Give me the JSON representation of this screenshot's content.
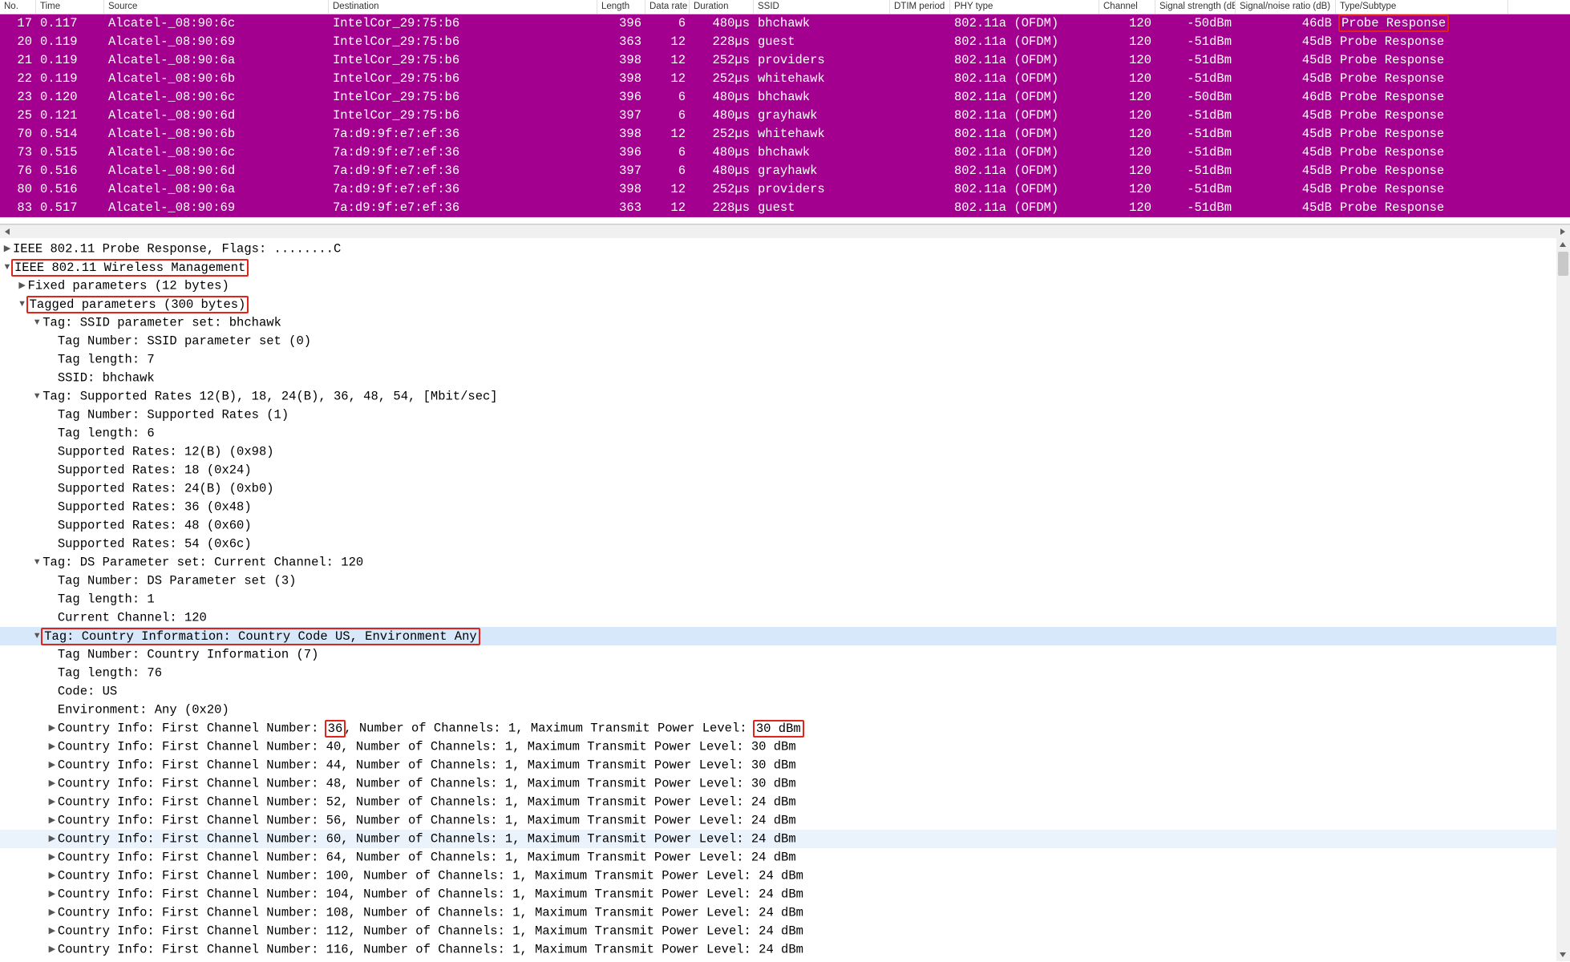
{
  "columns": [
    "No.",
    "Time",
    "Source",
    "Destination",
    "Length",
    "Data rate",
    "Duration",
    "SSID",
    "DTIM period",
    "PHY type",
    "Channel",
    "Signal strength (dBm)",
    "Signal/noise ratio (dB)",
    "Type/Subtype"
  ],
  "packets": [
    {
      "no": "17",
      "time": "0.117",
      "src": "Alcatel-_08:90:6c",
      "dst": "IntelCor_29:75:b6",
      "len": "396",
      "rate": "6",
      "dur": "480µs",
      "ssid": "bhchawk",
      "dtim": "",
      "phy": "802.11a (OFDM)",
      "chan": "120",
      "sig": "-50dBm",
      "snr": "46dB",
      "type": "Probe Response",
      "hlType": true
    },
    {
      "no": "20",
      "time": "0.119",
      "src": "Alcatel-_08:90:69",
      "dst": "IntelCor_29:75:b6",
      "len": "363",
      "rate": "12",
      "dur": "228µs",
      "ssid": "guest",
      "dtim": "",
      "phy": "802.11a (OFDM)",
      "chan": "120",
      "sig": "-51dBm",
      "snr": "45dB",
      "type": "Probe Response"
    },
    {
      "no": "21",
      "time": "0.119",
      "src": "Alcatel-_08:90:6a",
      "dst": "IntelCor_29:75:b6",
      "len": "398",
      "rate": "12",
      "dur": "252µs",
      "ssid": "providers",
      "dtim": "",
      "phy": "802.11a (OFDM)",
      "chan": "120",
      "sig": "-51dBm",
      "snr": "45dB",
      "type": "Probe Response"
    },
    {
      "no": "22",
      "time": "0.119",
      "src": "Alcatel-_08:90:6b",
      "dst": "IntelCor_29:75:b6",
      "len": "398",
      "rate": "12",
      "dur": "252µs",
      "ssid": "whitehawk",
      "dtim": "",
      "phy": "802.11a (OFDM)",
      "chan": "120",
      "sig": "-51dBm",
      "snr": "45dB",
      "type": "Probe Response"
    },
    {
      "no": "23",
      "time": "0.120",
      "src": "Alcatel-_08:90:6c",
      "dst": "IntelCor_29:75:b6",
      "len": "396",
      "rate": "6",
      "dur": "480µs",
      "ssid": "bhchawk",
      "dtim": "",
      "phy": "802.11a (OFDM)",
      "chan": "120",
      "sig": "-50dBm",
      "snr": "46dB",
      "type": "Probe Response"
    },
    {
      "no": "25",
      "time": "0.121",
      "src": "Alcatel-_08:90:6d",
      "dst": "IntelCor_29:75:b6",
      "len": "397",
      "rate": "6",
      "dur": "480µs",
      "ssid": "grayhawk",
      "dtim": "",
      "phy": "802.11a (OFDM)",
      "chan": "120",
      "sig": "-51dBm",
      "snr": "45dB",
      "type": "Probe Response"
    },
    {
      "no": "70",
      "time": "0.514",
      "src": "Alcatel-_08:90:6b",
      "dst": "7a:d9:9f:e7:ef:36",
      "len": "398",
      "rate": "12",
      "dur": "252µs",
      "ssid": "whitehawk",
      "dtim": "",
      "phy": "802.11a (OFDM)",
      "chan": "120",
      "sig": "-51dBm",
      "snr": "45dB",
      "type": "Probe Response"
    },
    {
      "no": "73",
      "time": "0.515",
      "src": "Alcatel-_08:90:6c",
      "dst": "7a:d9:9f:e7:ef:36",
      "len": "396",
      "rate": "6",
      "dur": "480µs",
      "ssid": "bhchawk",
      "dtim": "",
      "phy": "802.11a (OFDM)",
      "chan": "120",
      "sig": "-51dBm",
      "snr": "45dB",
      "type": "Probe Response"
    },
    {
      "no": "76",
      "time": "0.516",
      "src": "Alcatel-_08:90:6d",
      "dst": "7a:d9:9f:e7:ef:36",
      "len": "397",
      "rate": "6",
      "dur": "480µs",
      "ssid": "grayhawk",
      "dtim": "",
      "phy": "802.11a (OFDM)",
      "chan": "120",
      "sig": "-51dBm",
      "snr": "45dB",
      "type": "Probe Response"
    },
    {
      "no": "80",
      "time": "0.516",
      "src": "Alcatel-_08:90:6a",
      "dst": "7a:d9:9f:e7:ef:36",
      "len": "398",
      "rate": "12",
      "dur": "252µs",
      "ssid": "providers",
      "dtim": "",
      "phy": "802.11a (OFDM)",
      "chan": "120",
      "sig": "-51dBm",
      "snr": "45dB",
      "type": "Probe Response"
    },
    {
      "no": "83",
      "time": "0.517",
      "src": "Alcatel-_08:90:69",
      "dst": "7a:d9:9f:e7:ef:36",
      "len": "363",
      "rate": "12",
      "dur": "228µs",
      "ssid": "guest",
      "dtim": "",
      "phy": "802.11a (OFDM)",
      "chan": "120",
      "sig": "-51dBm",
      "snr": "45dB",
      "type": "Probe Response"
    }
  ],
  "tree": {
    "l0": "IEEE 802.11 Probe Response, Flags: ........C",
    "l1": "IEEE 802.11 Wireless Management",
    "l2": "Fixed parameters (12 bytes)",
    "l3": "Tagged parameters (300 bytes)",
    "l4": "Tag: SSID parameter set: bhchawk",
    "l5": "Tag Number: SSID parameter set (0)",
    "l6": "Tag length: 7",
    "l7": "SSID: bhchawk",
    "l8": "Tag: Supported Rates 12(B), 18, 24(B), 36, 48, 54, [Mbit/sec]",
    "l9": "Tag Number: Supported Rates (1)",
    "l10": "Tag length: 6",
    "l11": "Supported Rates: 12(B) (0x98)",
    "l12": "Supported Rates: 18 (0x24)",
    "l13": "Supported Rates: 24(B) (0xb0)",
    "l14": "Supported Rates: 36 (0x48)",
    "l15": "Supported Rates: 48 (0x60)",
    "l16": "Supported Rates: 54 (0x6c)",
    "l17": "Tag: DS Parameter set: Current Channel: 120",
    "l18": "Tag Number: DS Parameter set (3)",
    "l19": "Tag length: 1",
    "l20": "Current Channel: 120",
    "l21": "Tag: Country Information: Country Code US, Environment Any",
    "l22": "Tag Number: Country Information (7)",
    "l23": "Tag length: 76",
    "l24": "Code: US",
    "l25": "Environment: Any (0x20)",
    "ci_prefix": "Country Info: First Channel Number: ",
    "ci_mid": ", Number of Channels: 1, Maximum Transmit Power Level: ",
    "ci": [
      {
        "ch": "36",
        "pwr": "30 dBm",
        "hl": true
      },
      {
        "ch": "40",
        "pwr": "30 dBm"
      },
      {
        "ch": "44",
        "pwr": "30 dBm"
      },
      {
        "ch": "48",
        "pwr": "30 dBm"
      },
      {
        "ch": "52",
        "pwr": "24 dBm"
      },
      {
        "ch": "56",
        "pwr": "24 dBm"
      },
      {
        "ch": "60",
        "pwr": "24 dBm",
        "hov": true
      },
      {
        "ch": "64",
        "pwr": "24 dBm"
      },
      {
        "ch": "100",
        "pwr": "24 dBm"
      },
      {
        "ch": "104",
        "pwr": "24 dBm"
      },
      {
        "ch": "108",
        "pwr": "24 dBm"
      },
      {
        "ch": "112",
        "pwr": "24 dBm"
      },
      {
        "ch": "116",
        "pwr": "24 dBm"
      }
    ]
  }
}
